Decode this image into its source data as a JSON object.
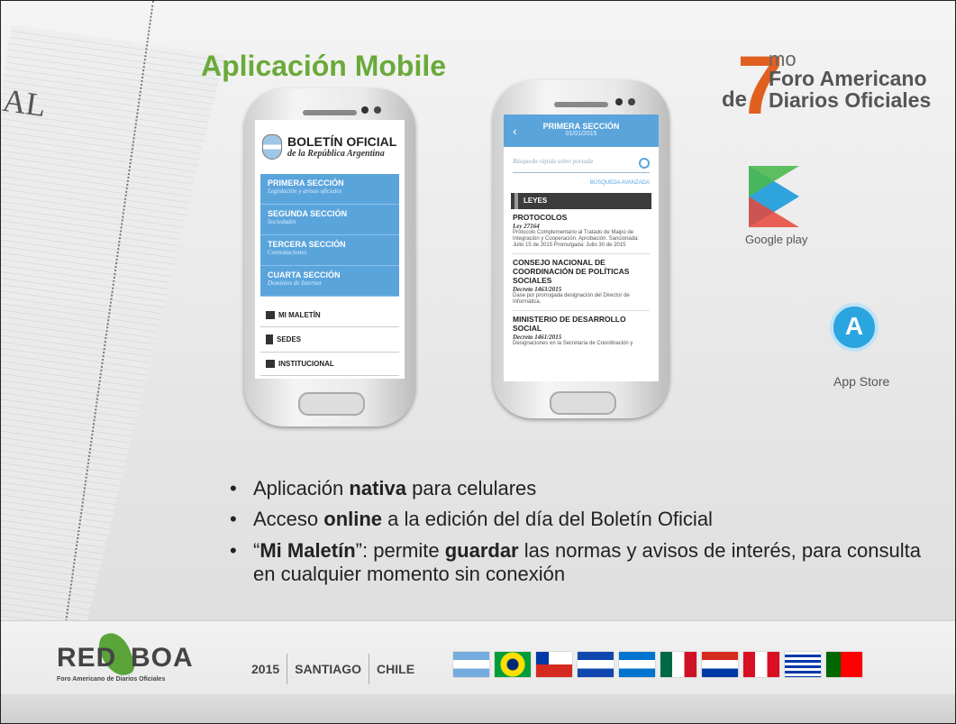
{
  "slide": {
    "title": "Aplicación Mobile",
    "decor_title": "AL"
  },
  "logo": {
    "number": "7",
    "superscript": "mo",
    "prefix": "de",
    "line1": "Foro Americano",
    "line2": "Diarios Oficiales",
    "accent_color": "#e06020"
  },
  "phone1": {
    "brand_title": "BOLETÍN OFICIAL",
    "brand_subtitle": "de la República Argentina",
    "sections": [
      {
        "name": "PRIMERA SECCIÓN",
        "desc": "Legislación y avisos oficiales"
      },
      {
        "name": "SEGUNDA SECCIÓN",
        "desc": "Sociedades"
      },
      {
        "name": "TERCERA SECCIÓN",
        "desc": "Contrataciones"
      },
      {
        "name": "CUARTA SECCIÓN",
        "desc": "Dominios de Internet"
      }
    ],
    "menu": [
      {
        "label": "MI MALETÍN",
        "icon": "briefcase-icon"
      },
      {
        "label": "SEDES",
        "icon": "building-icon"
      },
      {
        "label": "INSTITUCIONAL",
        "icon": "institution-icon"
      }
    ]
  },
  "phone2": {
    "header_title": "PRIMERA SECCIÓN",
    "header_date": "01/01/2015",
    "search_placeholder": "Búsqueda rápida sobre portada",
    "advanced_search": "BÚSQUEDA AVANZADA",
    "category": "LEYES",
    "items": [
      {
        "title": "PROTOCOLOS",
        "law": "Ley 27164",
        "text": "Protocolo Complementario al Tratado de Maipú de Integración y Cooperación. Aprobación. Sancionada: Julio 15 de 2015 Promulgada: Julio 30 de 2015"
      },
      {
        "title": "CONSEJO NACIONAL DE COORDINACIÓN DE POLÍTICAS SOCIALES",
        "law": "Decreto 1463/2015",
        "text": "Dase por prorrogada designación del Director de Informática."
      },
      {
        "title": "MINISTERIO DE DESARROLLO SOCIAL",
        "law": "Decreto 1461/2015",
        "text": "Designaciones en la Secretaría de Coordinación y"
      }
    ]
  },
  "stores": {
    "google_play": "Google play",
    "app_store": "App Store"
  },
  "bullets": [
    {
      "pre": "Aplicación ",
      "bold": "nativa",
      "post": " para celulares"
    },
    {
      "pre": "Acceso ",
      "bold": "online",
      "post": " a la edición del día del Boletín Oficial"
    },
    {
      "pre": "“",
      "bold": "Mi Maletín",
      "post": "”: permite ",
      "bold2": "guardar",
      "post2": " las normas y avisos de interés, para consulta en cualquier momento sin conexión"
    }
  ],
  "footer": {
    "org_left": "RED",
    "org_right": "BOA",
    "org_sub": "Foro Americano de Diarios Oficiales",
    "year": "2015",
    "city": "SANTIAGO",
    "country": "CHILE",
    "flags": [
      "argentina",
      "brazil",
      "chile",
      "el-salvador",
      "honduras",
      "mexico",
      "paraguay",
      "peru",
      "uruguay",
      "portugal"
    ]
  }
}
